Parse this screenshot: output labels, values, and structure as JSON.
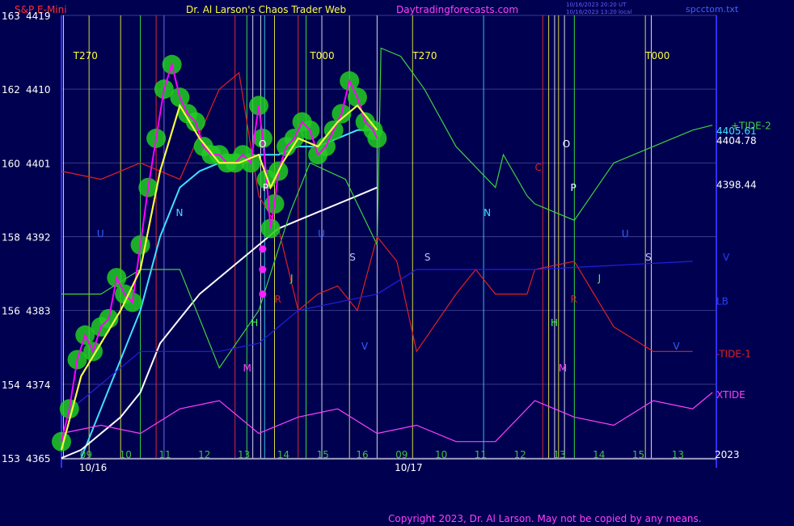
{
  "header": {
    "instrument": "S&P E-Mini",
    "site_title": "Dr. Al Larson's Chaos Trader Web",
    "site_url": "Daytradingforecasts.com",
    "timestamp_line1": "10/16/2023 20:20 UT",
    "timestamp_line2": "10/16/2023 13:20 local",
    "file_name": "spcctom.txt"
  },
  "footer": {
    "copyright": "Copyright 2023, Dr. Al Larson. May not be copied by any means."
  },
  "colors": {
    "background": "#000050",
    "price_bar": "#ff00ff",
    "energy_glow": "#22cc22",
    "ma_fast": "#ffff40",
    "ma_medium": "#40e0ff",
    "ma_slow": "#ffffff",
    "tide2": "#40d040",
    "tide1": "#e02020",
    "xtide": "#ff40ff",
    "lb": "#2020e0"
  },
  "chart_data": {
    "type": "line",
    "y_axis": {
      "ylim": [
        4365,
        4419
      ],
      "ticks": [
        {
          "left": "163",
          "right": "4419",
          "value": 4419
        },
        {
          "left": "162",
          "right": "4410",
          "value": 4410
        },
        {
          "left": "160",
          "right": "4401",
          "value": 4401
        },
        {
          "left": "158",
          "right": "4392",
          "value": 4392
        },
        {
          "left": "156",
          "right": "4383",
          "value": 4383
        },
        {
          "left": "154",
          "right": "4374",
          "value": 4374
        },
        {
          "left": "153",
          "right": "4365",
          "value": 4365
        }
      ]
    },
    "x_axis": {
      "xlim": [
        0,
        31
      ],
      "hour_ticks": [
        {
          "label": "09",
          "x": 1
        },
        {
          "label": "10",
          "x": 2
        },
        {
          "label": "11",
          "x": 3
        },
        {
          "label": "12",
          "x": 4
        },
        {
          "label": "13",
          "x": 5
        },
        {
          "label": "14",
          "x": 6
        },
        {
          "label": "15",
          "x": 7
        },
        {
          "label": "16",
          "x": 8
        },
        {
          "label": "09",
          "x": 9
        },
        {
          "label": "10",
          "x": 10
        },
        {
          "label": "11",
          "x": 11
        },
        {
          "label": "12",
          "x": 12
        },
        {
          "label": "13",
          "x": 13
        },
        {
          "label": "14",
          "x": 14
        },
        {
          "label": "15",
          "x": 15
        },
        {
          "label": "13",
          "x": 16
        }
      ],
      "date_ticks": [
        {
          "label": "10/16",
          "x": 0.8
        },
        {
          "label": "10/17",
          "x": 8.8
        }
      ],
      "year_label": {
        "label": "2023",
        "x": 16.6
      }
    },
    "series": [
      {
        "name": "price",
        "color": "#ff00ff",
        "points": [
          [
            0,
            4367
          ],
          [
            0.2,
            4371
          ],
          [
            0.4,
            4377
          ],
          [
            0.6,
            4380
          ],
          [
            0.8,
            4378
          ],
          [
            1,
            4381
          ],
          [
            1.2,
            4382
          ],
          [
            1.4,
            4387
          ],
          [
            1.6,
            4385
          ],
          [
            1.8,
            4384
          ],
          [
            2,
            4391
          ],
          [
            2.2,
            4398
          ],
          [
            2.4,
            4404
          ],
          [
            2.6,
            4410
          ],
          [
            2.8,
            4413
          ],
          [
            3.0,
            4409
          ],
          [
            3.2,
            4407
          ],
          [
            3.4,
            4406
          ],
          [
            3.6,
            4403
          ],
          [
            3.8,
            4402
          ],
          [
            4.0,
            4402
          ],
          [
            4.2,
            4401
          ],
          [
            4.4,
            4401
          ],
          [
            4.6,
            4402
          ],
          [
            4.8,
            4401
          ],
          [
            5.0,
            4408
          ],
          [
            5.1,
            4404
          ],
          [
            5.2,
            4399
          ],
          [
            5.3,
            4393
          ],
          [
            5.4,
            4396
          ],
          [
            5.5,
            4400
          ],
          [
            5.7,
            4403
          ],
          [
            5.9,
            4404
          ],
          [
            6.1,
            4406
          ],
          [
            6.3,
            4405
          ],
          [
            6.5,
            4402
          ],
          [
            6.7,
            4403
          ],
          [
            6.9,
            4405
          ],
          [
            7.1,
            4407
          ],
          [
            7.3,
            4411
          ],
          [
            7.5,
            4409
          ],
          [
            7.7,
            4406
          ],
          [
            7.9,
            4405
          ],
          [
            8.0,
            4404
          ]
        ]
      },
      {
        "name": "",
        "color": "#ffff40",
        "points": [
          [
            0,
            4366
          ],
          [
            0.5,
            4375
          ],
          [
            1,
            4379
          ],
          [
            1.5,
            4383
          ],
          [
            2,
            4388
          ],
          [
            2.5,
            4400
          ],
          [
            3,
            4408
          ],
          [
            3.5,
            4404
          ],
          [
            4,
            4401
          ],
          [
            4.5,
            4401
          ],
          [
            5,
            4402
          ],
          [
            5.3,
            4398
          ],
          [
            5.6,
            4401
          ],
          [
            6,
            4404
          ],
          [
            6.5,
            4403
          ],
          [
            7,
            4406
          ],
          [
            7.5,
            4408
          ],
          [
            8,
            4405
          ]
        ]
      },
      {
        "name": "",
        "color": "#40e0ff",
        "points": [
          [
            0.5,
            4365
          ],
          [
            1,
            4371
          ],
          [
            1.5,
            4377
          ],
          [
            2,
            4383
          ],
          [
            2.5,
            4392
          ],
          [
            3,
            4398
          ],
          [
            3.5,
            4400
          ],
          [
            4,
            4401
          ],
          [
            4.5,
            4401
          ],
          [
            5,
            4402
          ],
          [
            5.5,
            4402
          ],
          [
            6,
            4403
          ],
          [
            6.5,
            4403
          ],
          [
            7,
            4404
          ],
          [
            7.5,
            4405
          ],
          [
            8,
            4405
          ]
        ]
      },
      {
        "name": "",
        "color": "#ffffff",
        "points": [
          [
            0,
            4365
          ],
          [
            0.5,
            4366
          ],
          [
            1,
            4368
          ],
          [
            1.5,
            4370
          ],
          [
            2,
            4373
          ],
          [
            2.5,
            4379
          ],
          [
            3,
            4382
          ],
          [
            3.5,
            4385
          ],
          [
            4,
            4387
          ],
          [
            4.5,
            4389
          ],
          [
            5,
            4391
          ],
          [
            5.5,
            4393
          ],
          [
            6,
            4394
          ],
          [
            6.5,
            4395
          ],
          [
            7,
            4396
          ],
          [
            7.5,
            4397
          ],
          [
            8,
            4398
          ]
        ]
      },
      {
        "name": "+TIDE-2",
        "color": "#40d040",
        "points": [
          [
            0,
            4385
          ],
          [
            1,
            4385
          ],
          [
            2,
            4388
          ],
          [
            3,
            4388
          ],
          [
            4,
            4376
          ],
          [
            5,
            4383
          ],
          [
            5.8,
            4395
          ],
          [
            6.3,
            4401
          ],
          [
            7.2,
            4399
          ],
          [
            8,
            4391
          ],
          [
            8.1,
            4415
          ],
          [
            8.6,
            4414
          ],
          [
            9.2,
            4410
          ],
          [
            10,
            4403
          ],
          [
            11,
            4398
          ],
          [
            11.2,
            4402
          ],
          [
            11.8,
            4397
          ],
          [
            12,
            4396
          ],
          [
            13,
            4394
          ],
          [
            14,
            4401
          ],
          [
            15,
            4403
          ],
          [
            16,
            4405
          ],
          [
            16.5,
            4405.6
          ]
        ]
      },
      {
        "name": "-TIDE-1",
        "color": "#e02020",
        "points": [
          [
            0,
            4400
          ],
          [
            1,
            4399
          ],
          [
            2,
            4401
          ],
          [
            3,
            4399
          ],
          [
            4,
            4410
          ],
          [
            4.5,
            4412
          ],
          [
            5,
            4397
          ],
          [
            5.5,
            4393
          ],
          [
            6,
            4383
          ],
          [
            6.5,
            4385
          ],
          [
            7,
            4386
          ],
          [
            7.5,
            4383
          ],
          [
            8,
            4392
          ],
          [
            8.5,
            4389
          ],
          [
            9,
            4378
          ],
          [
            10,
            4385
          ],
          [
            10.5,
            4388
          ],
          [
            11,
            4385
          ],
          [
            11.8,
            4385
          ],
          [
            12,
            4388
          ],
          [
            13,
            4389
          ],
          [
            13.5,
            4385
          ],
          [
            14,
            4381
          ],
          [
            15,
            4378
          ],
          [
            16,
            4378
          ]
        ]
      },
      {
        "name": "LB",
        "color": "#2020e0",
        "points": [
          [
            0,
            4370
          ],
          [
            2,
            4378
          ],
          [
            3,
            4378
          ],
          [
            4,
            4378
          ],
          [
            5,
            4379
          ],
          [
            6,
            4383
          ],
          [
            8,
            4385
          ],
          [
            9,
            4388
          ],
          [
            12,
            4388
          ],
          [
            16,
            4389
          ]
        ]
      },
      {
        "name": "XTIDE",
        "color": "#ff40ff",
        "points": [
          [
            0,
            4368
          ],
          [
            1,
            4369
          ],
          [
            2,
            4368
          ],
          [
            3,
            4371
          ],
          [
            4,
            4372
          ],
          [
            5,
            4368
          ],
          [
            6,
            4370
          ],
          [
            7,
            4371
          ],
          [
            8,
            4368
          ],
          [
            9,
            4369
          ],
          [
            10,
            4367
          ],
          [
            11,
            4367
          ],
          [
            12,
            4372
          ],
          [
            13,
            4370
          ],
          [
            14,
            4369
          ],
          [
            15,
            4372
          ],
          [
            16,
            4371
          ],
          [
            16.5,
            4373
          ]
        ]
      }
    ],
    "markers": [
      {
        "label": "T270",
        "x": 0.3
      },
      {
        "label": "T000",
        "x": 6.3
      },
      {
        "label": "T270",
        "x": 8.9
      },
      {
        "label": "T000",
        "x": 14.8
      },
      {
        "label": "N",
        "x": 2.9
      },
      {
        "label": "N",
        "x": 10.7
      },
      {
        "label": "O",
        "x": 5.0
      },
      {
        "label": "O",
        "x": 12.7
      },
      {
        "label": "P",
        "x": 5.1
      },
      {
        "label": "P",
        "x": 12.9
      },
      {
        "label": "S",
        "x": 7.3
      },
      {
        "label": "S",
        "x": 9.2
      },
      {
        "label": "S",
        "x": 14.8
      },
      {
        "label": "J",
        "x": 5.8
      },
      {
        "label": "J",
        "x": 13.6
      },
      {
        "label": "H",
        "x": 4.8
      },
      {
        "label": "H",
        "x": 12.4
      },
      {
        "label": "M",
        "x": 4.6
      },
      {
        "label": "M",
        "x": 12.6
      },
      {
        "label": "C",
        "x": 12.0
      },
      {
        "label": "R",
        "x": 5.4
      },
      {
        "label": "R",
        "x": 12.9
      },
      {
        "label": "V",
        "x": 7.6
      },
      {
        "label": "V",
        "x": 15.5
      },
      {
        "label": "U",
        "x": 0.9
      },
      {
        "label": "U",
        "x": 6.5
      },
      {
        "label": "U",
        "x": 14.2
      }
    ],
    "right_labels": [
      {
        "label": "+TIDE-2",
        "color": "#40d040",
        "value": 4405.6
      },
      {
        "label": "4405.61",
        "color": "#40e0ff",
        "value": 4405.0
      },
      {
        "label": "4404.78",
        "color": "#ffffff",
        "value": 4403.8
      },
      {
        "label": "4398.44",
        "color": "#ffffff",
        "value": 4398.4
      },
      {
        "label": "V",
        "color": "#2040ff",
        "value": 4389.6
      },
      {
        "label": "LB",
        "color": "#2040ff",
        "value": 4384.2
      },
      {
        "label": "-TIDE-1",
        "color": "#e02020",
        "value": 4377.8
      },
      {
        "label": "XTIDE",
        "color": "#ff40ff",
        "value": 4372.8
      }
    ],
    "price_dots": [
      4390.5,
      4388.0,
      4385.0
    ],
    "vertical_lines": [
      {
        "x": 0.05,
        "color": "#ffffff"
      },
      {
        "x": 0.7,
        "color": "#ffff40"
      },
      {
        "x": 1.5,
        "color": "#ffff40"
      },
      {
        "x": 2.0,
        "color": "#40ff40"
      },
      {
        "x": 2.4,
        "color": "#ff3030"
      },
      {
        "x": 2.6,
        "color": "#8080ff"
      },
      {
        "x": 4.4,
        "color": "#ff3030"
      },
      {
        "x": 4.7,
        "color": "#40ff40"
      },
      {
        "x": 4.85,
        "color": "#ffffff"
      },
      {
        "x": 5.05,
        "color": "#ffffff"
      },
      {
        "x": 5.15,
        "color": "#40e0ff"
      },
      {
        "x": 5.4,
        "color": "#ffff40"
      },
      {
        "x": 6.0,
        "color": "#ff3030"
      },
      {
        "x": 6.2,
        "color": "#40ff40"
      },
      {
        "x": 6.6,
        "color": "#ffffff"
      },
      {
        "x": 7.3,
        "color": "#ffff40"
      },
      {
        "x": 8.0,
        "color": "#ffffff"
      },
      {
        "x": 8.9,
        "color": "#ffff40"
      },
      {
        "x": 10.7,
        "color": "#40e0ff"
      },
      {
        "x": 12.2,
        "color": "#ff3030"
      },
      {
        "x": 12.35,
        "color": "#ffff40"
      },
      {
        "x": 12.5,
        "color": "#ffffff"
      },
      {
        "x": 12.6,
        "color": "#ffff40"
      },
      {
        "x": 12.75,
        "color": "#ffffff"
      },
      {
        "x": 13.0,
        "color": "#40ff40"
      },
      {
        "x": 14.8,
        "color": "#ffff40"
      },
      {
        "x": 14.95,
        "color": "#ffffff"
      }
    ]
  }
}
